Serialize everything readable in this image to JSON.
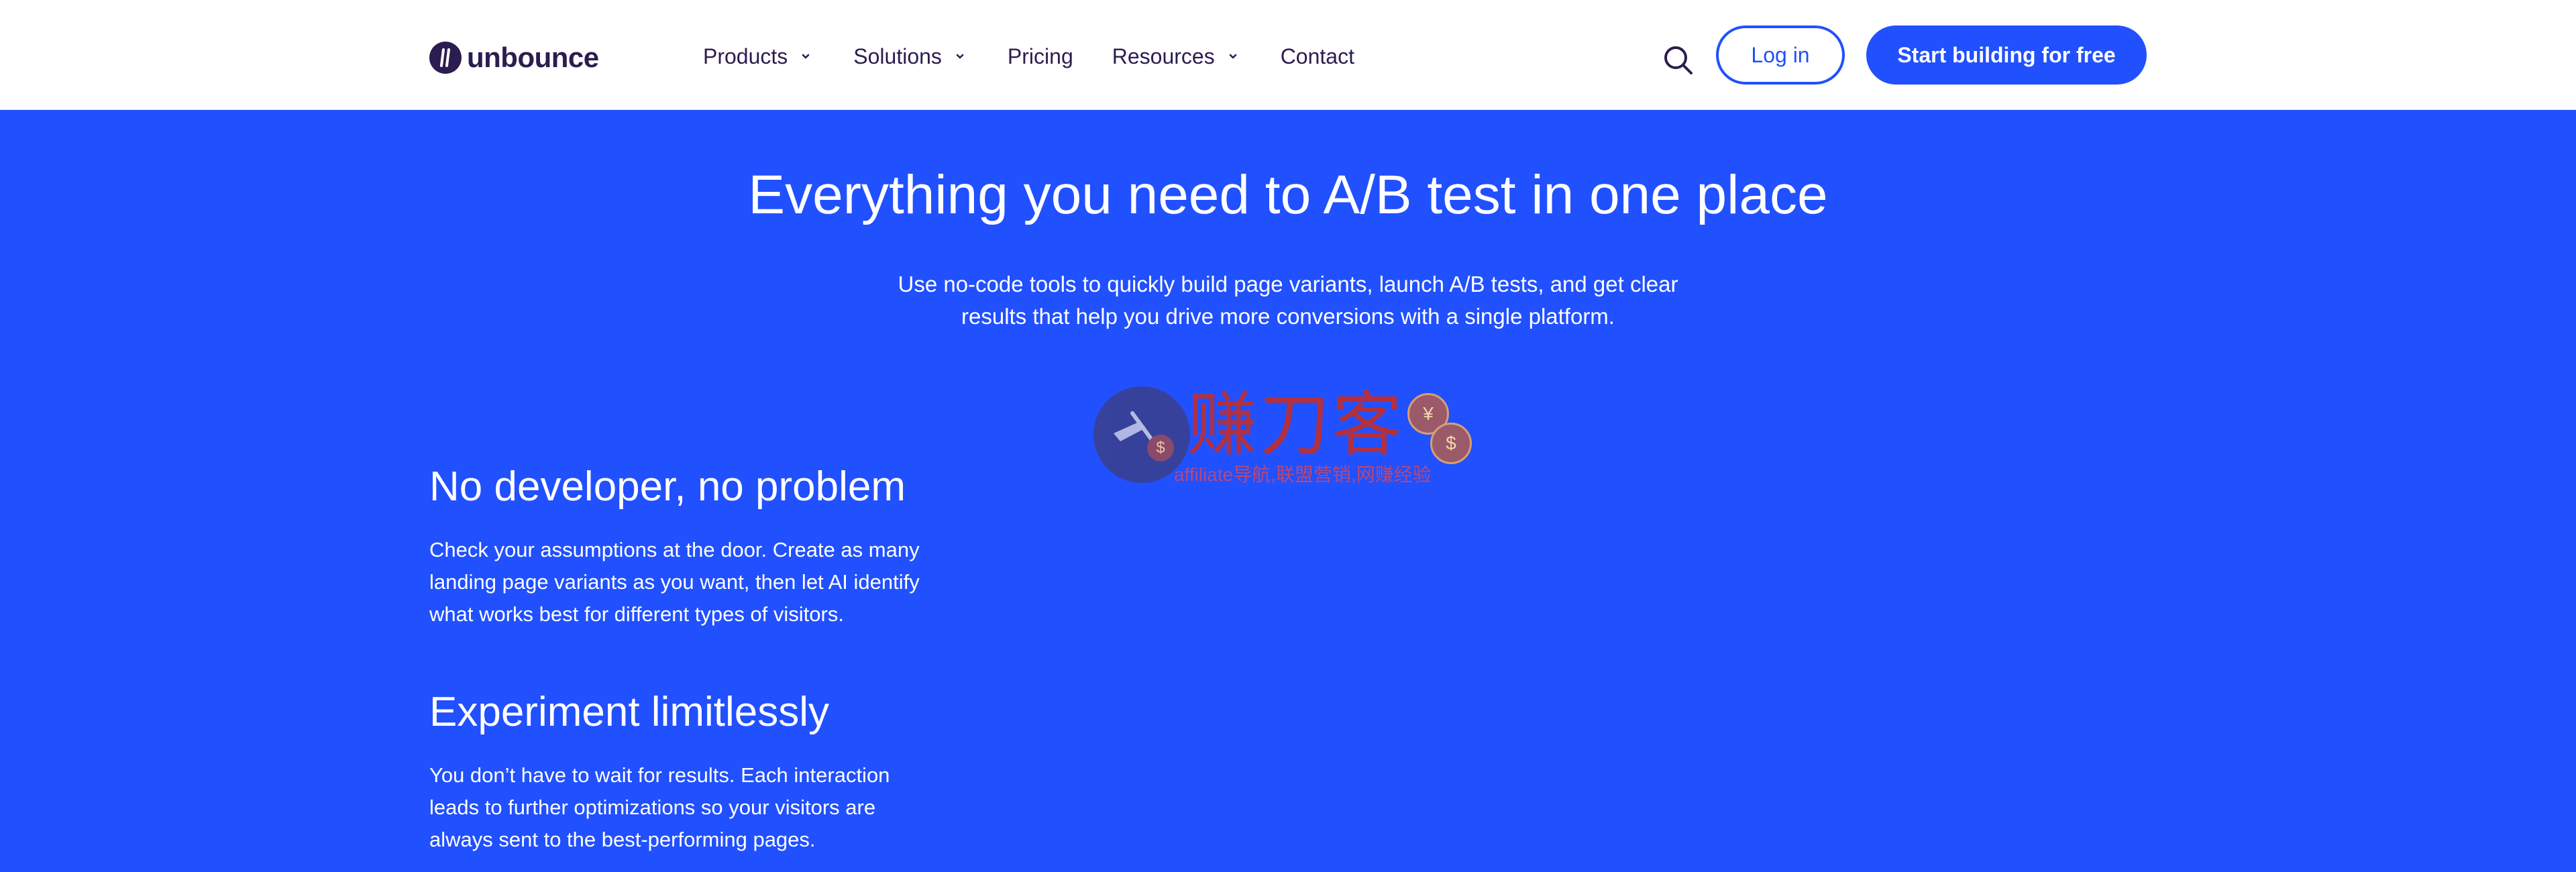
{
  "header": {
    "logo_text": "unbounce",
    "nav": [
      {
        "label": "Products",
        "has_dropdown": true
      },
      {
        "label": "Solutions",
        "has_dropdown": true
      },
      {
        "label": "Pricing",
        "has_dropdown": false
      },
      {
        "label": "Resources",
        "has_dropdown": true
      },
      {
        "label": "Contact",
        "has_dropdown": false
      }
    ],
    "login_label": "Log in",
    "cta_label": "Start building for free"
  },
  "hero": {
    "title": "Everything you need to A/B test in one place",
    "subtitle_line1": "Use no-code tools to quickly build page variants, launch A/B tests, and get clear",
    "subtitle_line2": "results that help you drive more conversions with a single platform."
  },
  "watermark": {
    "main_text": "赚刀客",
    "sub_text": "affiliate导航,联盟营销,网赚经验",
    "coin_symbol": "$",
    "coin_symbol_2": "¥"
  },
  "features": [
    {
      "title": "No developer, no problem",
      "lines": [
        "Check your assumptions at the door. Create as many",
        "landing page variants as you want, then let AI identify",
        "what works best for different types of visitors."
      ]
    },
    {
      "title": "Experiment limitlessly",
      "lines": [
        "You don’t have to wait for results. Each interaction",
        "leads to further optimizations so your visitors are",
        "always sent to the best-performing pages."
      ]
    }
  ],
  "colors": {
    "brand_blue": "#2150ff",
    "brand_dark": "#2b1d4f",
    "header_bg": "#ffffff"
  }
}
